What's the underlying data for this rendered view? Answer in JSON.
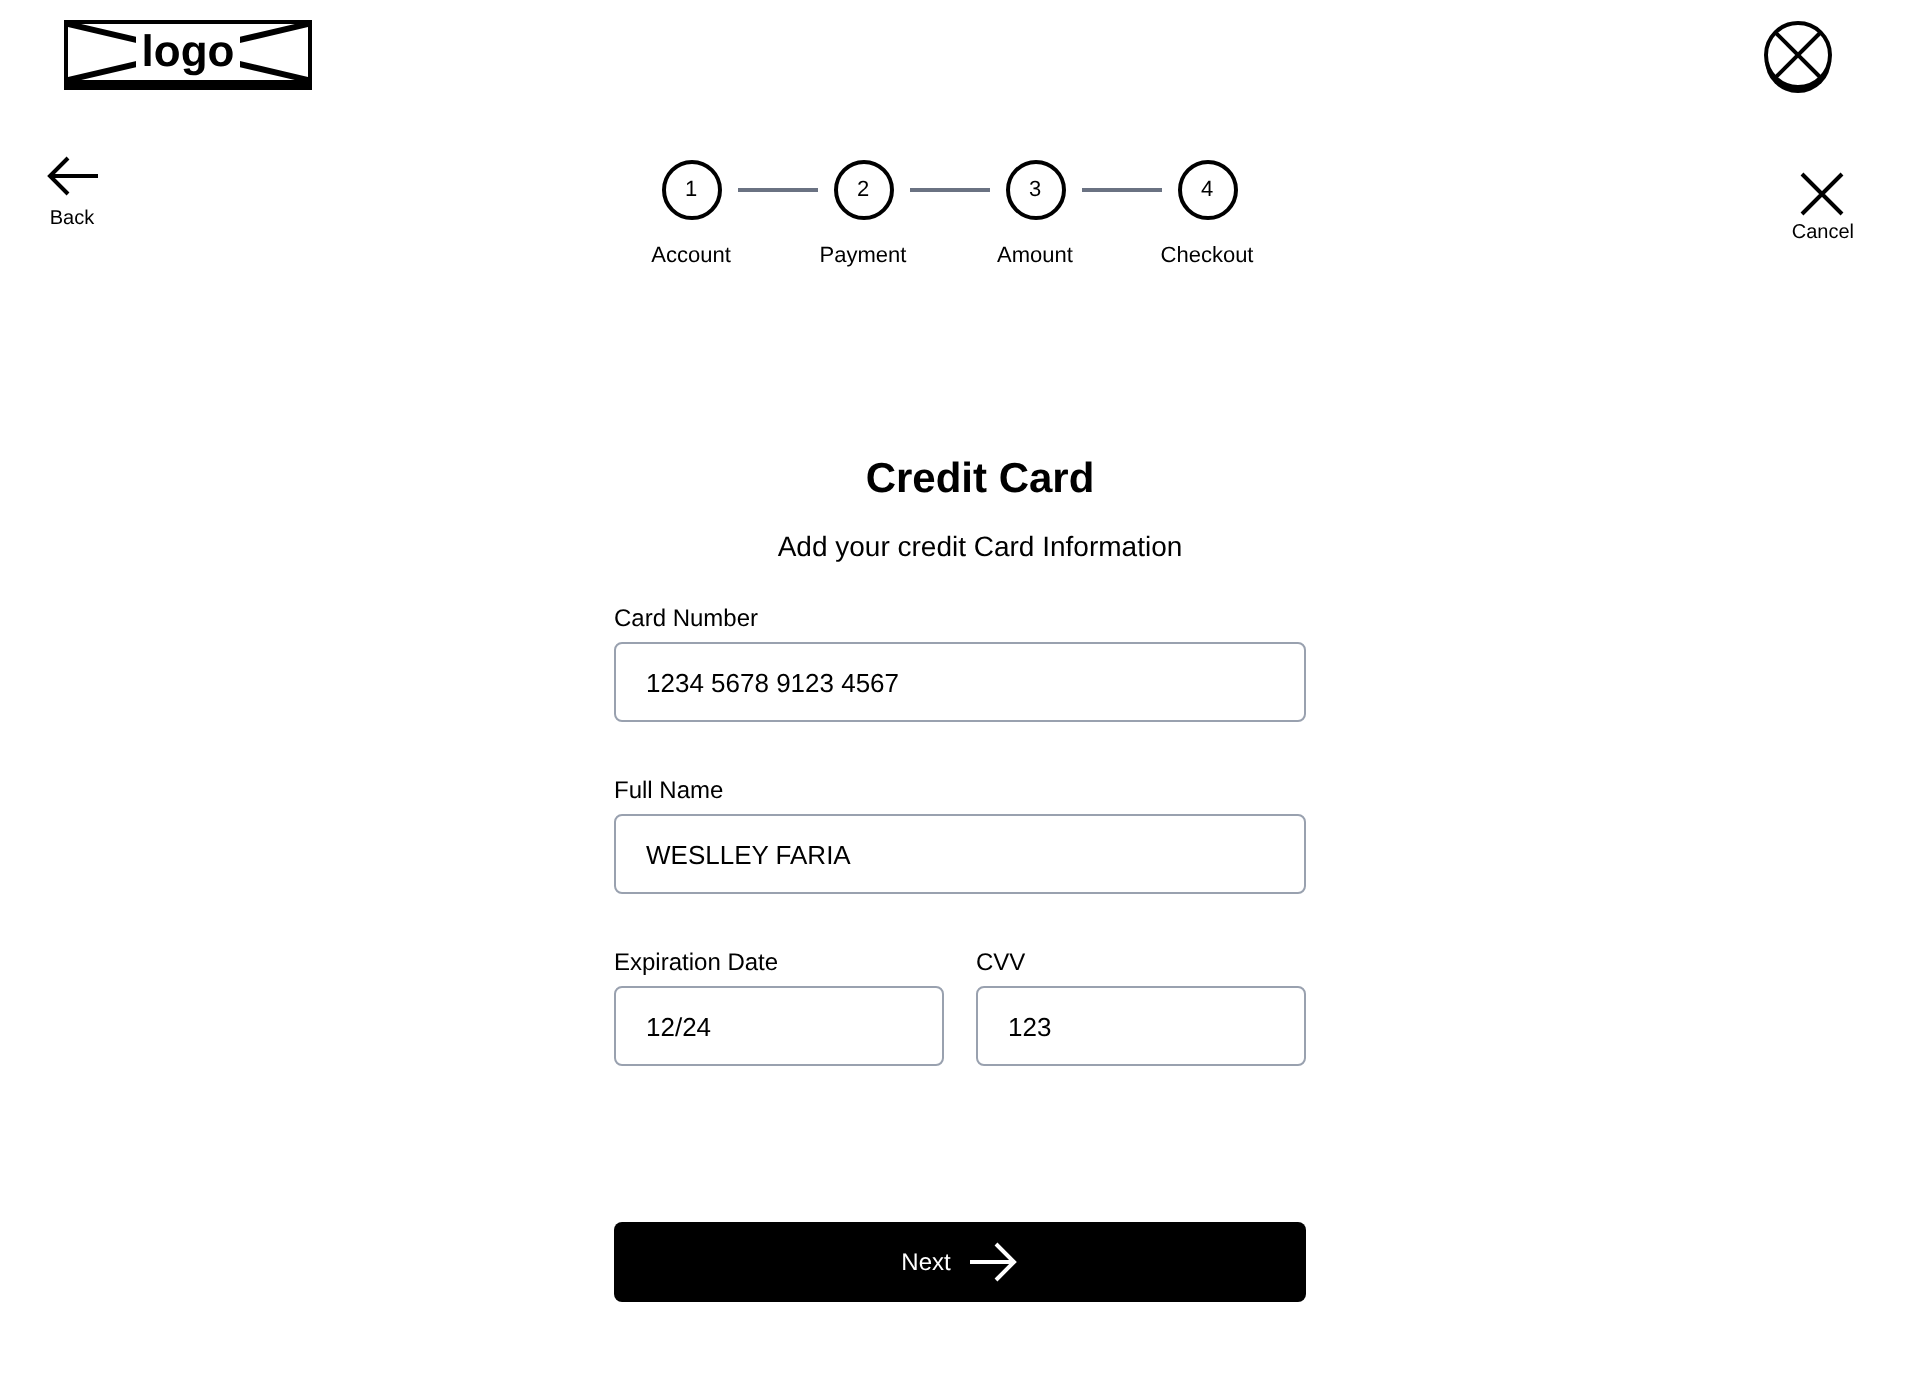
{
  "header": {
    "logo": "logo"
  },
  "nav": {
    "back": "Back",
    "cancel": "Cancel"
  },
  "steps": [
    {
      "number": "1",
      "label": "Account"
    },
    {
      "number": "2",
      "label": "Payment"
    },
    {
      "number": "3",
      "label": "Amount"
    },
    {
      "number": "4",
      "label": "Checkout"
    }
  ],
  "form": {
    "title": "Credit Card",
    "subtitle": "Add your credit Card Information",
    "rows": [
      [
        {
          "label": "Card Number",
          "value": "1234 5678 9123 4567"
        }
      ],
      [
        {
          "label": "Full Name",
          "value": "WESLLEY FARIA"
        }
      ],
      [
        {
          "label": "Expiration Date",
          "value": "12/24"
        },
        {
          "label": "CVV",
          "value": "123"
        }
      ]
    ],
    "submit": "Next"
  }
}
